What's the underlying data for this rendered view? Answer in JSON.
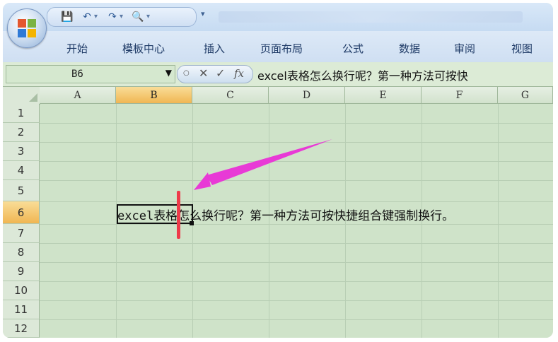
{
  "ribbon": {
    "tabs": [
      "开始",
      "模板中心",
      "插入",
      "页面布局",
      "公式",
      "数据",
      "审阅",
      "视图"
    ]
  },
  "formula_bar": {
    "name_box": "B6",
    "cancel_symbol": "✕",
    "enter_symbol": "✓",
    "fx_label": "fx",
    "content": "excel表格怎么换行呢？第一种方法可按快"
  },
  "sheet": {
    "columns": [
      "A",
      "B",
      "C",
      "D",
      "E",
      "F",
      "G"
    ],
    "active_column": "B",
    "rows": [
      "1",
      "2",
      "3",
      "4",
      "5",
      "6",
      "7",
      "8",
      "9",
      "10",
      "11",
      "12"
    ],
    "active_row": "6",
    "cell_content_latin": "excel",
    "cell_content_cjk": "表格怎么换行呢？第一种方法可按快捷组合键强制换行。"
  },
  "icons": {
    "office_button": "office-logo-icon",
    "save": "save-icon",
    "undo": "undo-icon",
    "redo": "redo-icon",
    "print_preview": "print-preview-icon",
    "qat_customize": "dropdown-icon"
  },
  "colors": {
    "sheet_background": "#cfe3c9",
    "active_header": "#f0b653",
    "annotation_arrow": "#e83ad6",
    "cursor_marker": "#ee3a4a"
  }
}
